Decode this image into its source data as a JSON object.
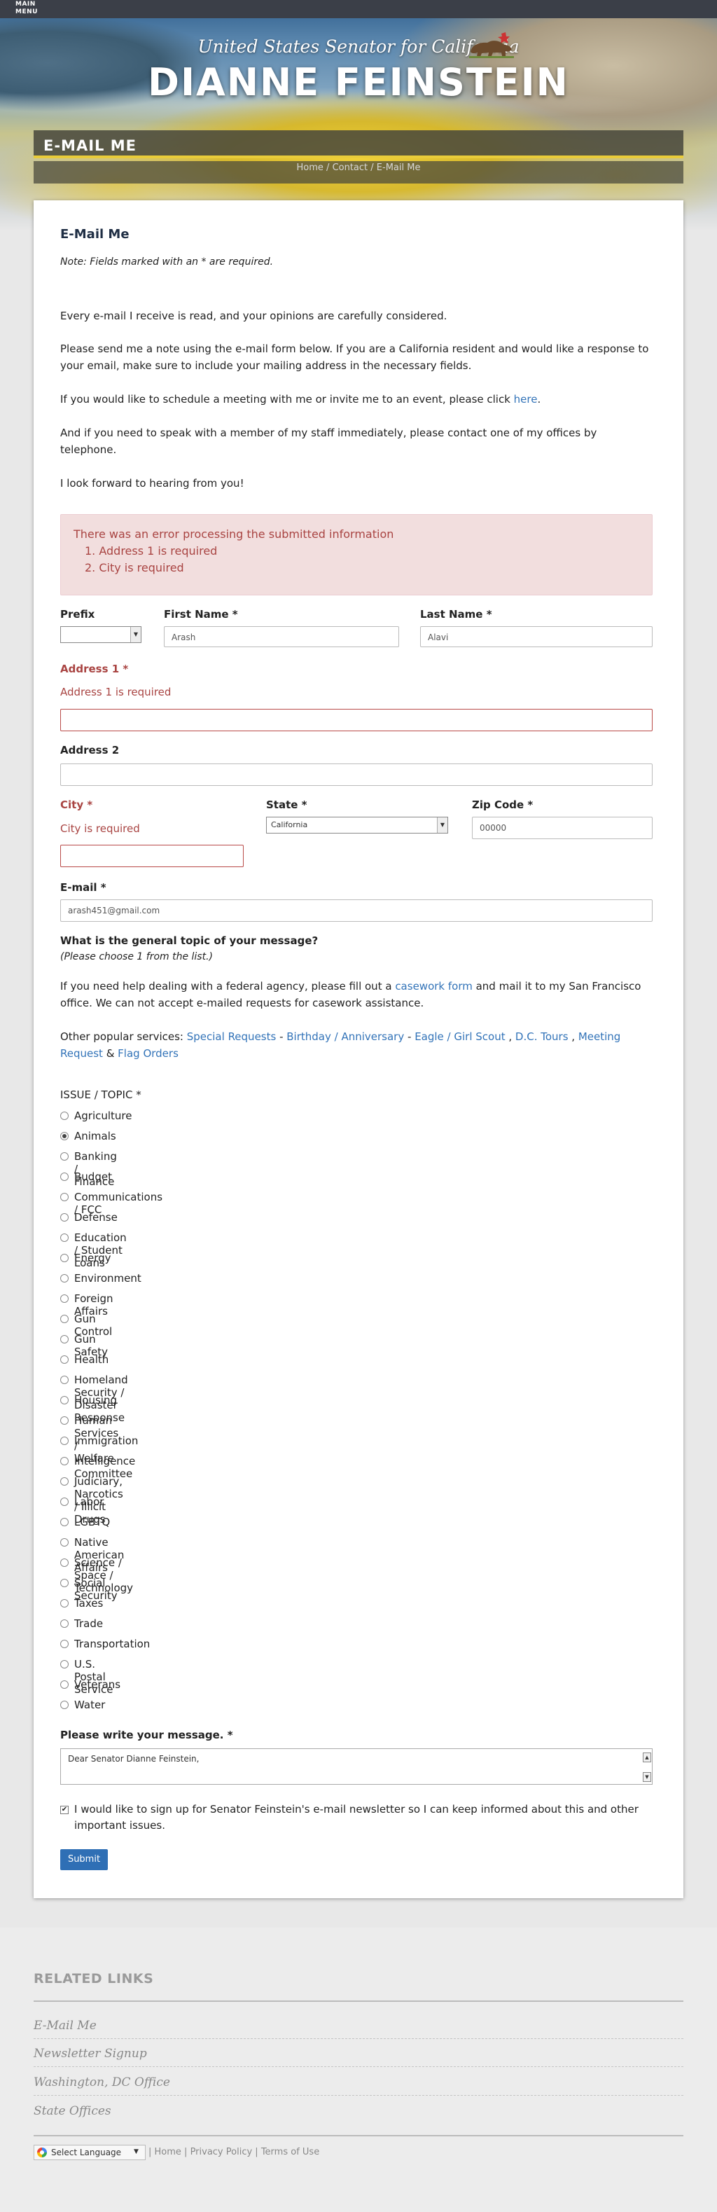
{
  "topbar": {
    "menu_line1": "MAIN",
    "menu_line2": "MENU"
  },
  "hero": {
    "subtitle": "United States Senator for California",
    "title": "DIANNE FEINSTEIN"
  },
  "band": {
    "title": "E-MAIL ME"
  },
  "breadcrumb": {
    "home": "Home",
    "sep1": " / ",
    "contact": "Contact",
    "sep2": " / ",
    "current": "E-Mail Me"
  },
  "form": {
    "title": "E-Mail Me",
    "note": "Note: Fields marked with an * are required.",
    "p1": "Every e-mail I receive is read, and your opinions are carefully considered.",
    "p2": "Please send me a note using the e-mail form below. If you are a California resident and would like a response to your email, make sure to include your mailing address in the necessary fields.",
    "p3_pre": "If you would like to schedule a meeting with me or invite me to an event, please click ",
    "p3_link": "here",
    "p3_post": ".",
    "p4": "And if you need to speak with a member of my staff immediately, please contact one of my offices by telephone.",
    "p5": "I look forward to hearing from you!",
    "error": {
      "heading": "There was an error processing the submitted information",
      "items": [
        "1.   Address 1 is required",
        "2.   City is required"
      ]
    },
    "prefix_label": "Prefix",
    "prefix_value": "",
    "first_name_label": "First Name *",
    "first_name_value": "Arash",
    "last_name_label": "Last Name *",
    "last_name_value": "Alavi",
    "address1_label": "Address 1 *",
    "address1_error": "Address 1 is required",
    "address1_value": "",
    "address2_label": "Address 2",
    "address2_value": "",
    "city_label": "City *",
    "city_error": "City is required",
    "city_value": "",
    "state_label": "State *",
    "state_value": "California",
    "zip_label": "Zip Code *",
    "zip_value": "00000",
    "email_label": "E-mail *",
    "email_value": "arash451@gmail.com",
    "topic_question": "What is the general topic of your message?",
    "topic_hint": "(Please choose 1 from the list.)",
    "casework_pre": "If you need help dealing with a federal agency, please fill out a ",
    "casework_link": "casework form",
    "casework_post": " and mail it to my San Francisco office. We can not accept e-mailed requests for casework assistance.",
    "services_pre": "Other popular services: ",
    "services": {
      "special": "Special Requests",
      "birthday": "Birthday / Anniversary",
      "eagle": "Eagle / Girl Scout",
      "dc": "D.C. Tours",
      "meeting": "Meeting Request",
      "flag": "Flag Orders",
      "sep_dash": " - ",
      "sep_comma": " , ",
      "sep_amp": " & "
    },
    "issue_label": "ISSUE / TOPIC *",
    "topics": [
      "Agriculture",
      "Animals",
      "Banking / Finance",
      "Budget",
      "Communications / FCC",
      "Defense",
      "Education / Student Loans",
      "Energy",
      "Environment",
      "Foreign Affairs",
      "Gun Control",
      "Gun Safety",
      "Health",
      "Homeland Security / Disaster Response",
      "Housing",
      "Human Services / Welfare",
      "Immigration",
      "Intelligence Committee",
      "Judiciary, Narcotics / Illicit Drugs",
      "Labor",
      "LGBTQ",
      "Native American Affairs",
      "Science / Space / Technology",
      "Social Security",
      "Taxes",
      "Trade",
      "Transportation",
      "U.S. Postal Service",
      "Veterans",
      "Water"
    ],
    "selected_topic": "Animals",
    "message_label": "Please write your message. *",
    "message_value": "Dear Senator Dianne Feinstein,",
    "newsletter_checked": true,
    "newsletter_text": "I would like to sign up for Senator Feinstein's e-mail newsletter so I can keep informed about this and other important issues.",
    "submit_label": "Submit"
  },
  "footer": {
    "related_title": "RELATED LINKS",
    "links": [
      "E-Mail Me",
      "Newsletter Signup",
      "Washington, DC Office",
      "State Offices"
    ],
    "translate_label": "Select Language",
    "bottom_links": [
      "Home",
      "Privacy Policy",
      "Terms of Use"
    ],
    "bottom_sep": " | "
  }
}
